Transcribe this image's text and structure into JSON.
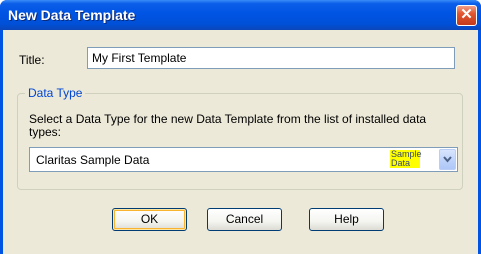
{
  "window": {
    "title": "New Data Template",
    "close_icon": "close-icon"
  },
  "form": {
    "title_label": "Title:",
    "title_value": "My First Template",
    "group_label": "Data Type",
    "description": "Select a Data Type for the new Data Template from the list of installed data types:",
    "data_type": {
      "selected": "Claritas Sample Data",
      "badge_line1": "Sample",
      "badge_line2": "Data",
      "dropdown_icon": "chevron-down-icon"
    }
  },
  "buttons": {
    "ok": "OK",
    "cancel": "Cancel",
    "help": "Help"
  },
  "colors": {
    "titlebar": "#0054e3",
    "dialog_bg": "#ece9d8",
    "group_label": "#0046d5",
    "badge": "#ffff00"
  }
}
